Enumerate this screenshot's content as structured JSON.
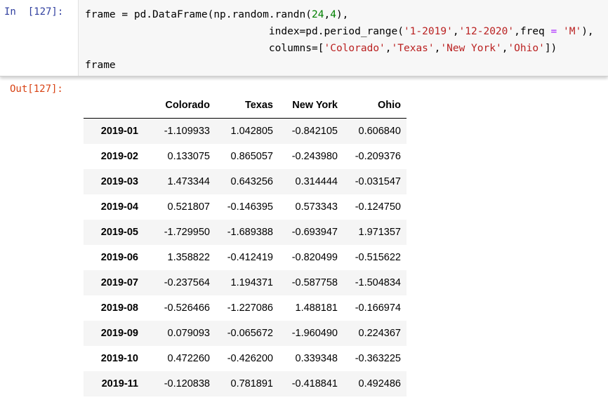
{
  "input_prompt": "In  [127]:",
  "output_prompt": "Out[127]:",
  "code": {
    "line1": {
      "a": "frame = pd.DataFrame(np.random.randn(",
      "n1": "24",
      "b": ",",
      "n2": "4",
      "c": "),"
    },
    "line2": {
      "pad": "                              ",
      "a": "index=pd.period_range(",
      "s1": "'1-2019'",
      "b": ",",
      "s2": "'12-2020'",
      "c": ",freq ",
      "op": "=",
      "d": " ",
      "s3": "'M'",
      "e": "),"
    },
    "line3": {
      "pad": "                              ",
      "a": "columns=[",
      "s1": "'Colorado'",
      "b1": ",",
      "s2": "'Texas'",
      "b2": ",",
      "s3": "'New York'",
      "b3": ",",
      "s4": "'Ohio'",
      "c": "])"
    },
    "line4": "frame"
  },
  "table": {
    "columns": [
      "",
      "Colorado",
      "Texas",
      "New York",
      "Ohio"
    ],
    "rows": [
      [
        "2019-01",
        "-1.109933",
        "1.042805",
        "-0.842105",
        "0.606840"
      ],
      [
        "2019-02",
        "0.133075",
        "0.865057",
        "-0.243980",
        "-0.209376"
      ],
      [
        "2019-03",
        "1.473344",
        "0.643256",
        "0.314444",
        "-0.031547"
      ],
      [
        "2019-04",
        "0.521807",
        "-0.146395",
        "0.573343",
        "-0.124750"
      ],
      [
        "2019-05",
        "-1.729950",
        "-1.689388",
        "-0.693947",
        "1.971357"
      ],
      [
        "2019-06",
        "1.358822",
        "-0.412419",
        "-0.820499",
        "-0.515622"
      ],
      [
        "2019-07",
        "-0.237564",
        "1.194371",
        "-0.587758",
        "-1.504834"
      ],
      [
        "2019-08",
        "-0.526466",
        "-1.227086",
        "1.488181",
        "-0.166974"
      ],
      [
        "2019-09",
        "0.079093",
        "-0.065672",
        "-1.960490",
        "0.224367"
      ],
      [
        "2019-10",
        "0.472260",
        "-0.426200",
        "0.339348",
        "-0.363225"
      ],
      [
        "2019-11",
        "-0.120838",
        "0.781891",
        "-0.418841",
        "0.492486"
      ]
    ]
  }
}
